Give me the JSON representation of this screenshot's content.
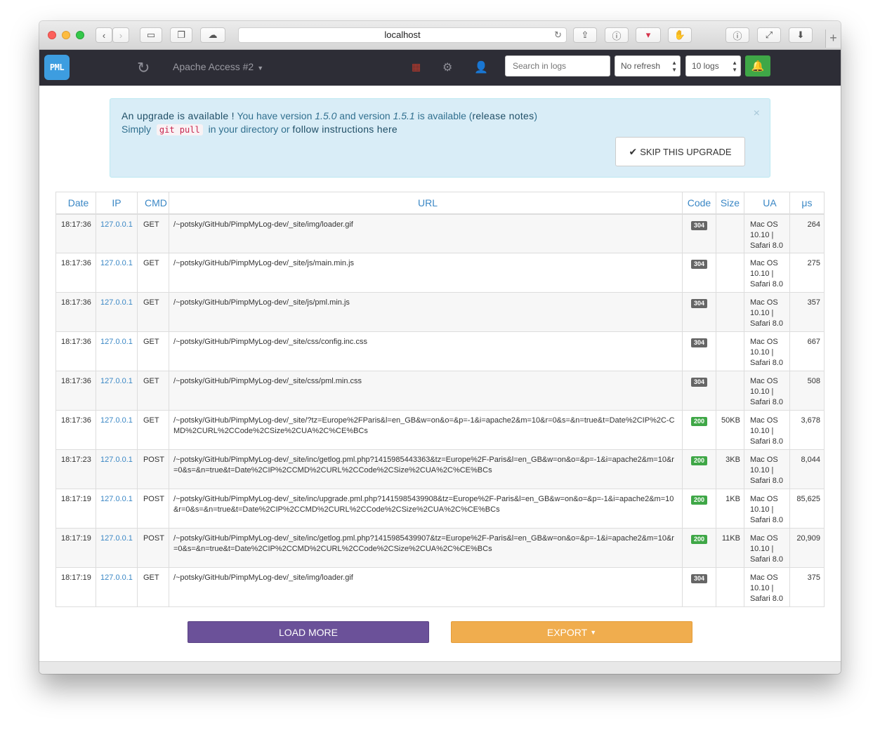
{
  "browser": {
    "url": "localhost"
  },
  "navbar": {
    "logo_text": "PML",
    "log_title": "Apache Access #2",
    "search_placeholder": "Search in logs",
    "refresh_selected": "No refresh",
    "logs_selected": "10 logs"
  },
  "alert": {
    "upgrade_available": "An upgrade is available !",
    "you_have": "You have version",
    "current_version": "1.5.0",
    "and_version": "and version",
    "new_version": "1.5.1",
    "is_available": "is available (",
    "release_notes": "release notes",
    "paren_close": ")",
    "simply": "Simply",
    "git_pull": "git pull",
    "in_dir": "in your directory or",
    "follow": "follow instructions here",
    "close": "×",
    "skip_label": "SKIP THIS UPGRADE"
  },
  "table": {
    "headers": [
      "Date",
      "IP",
      "CMD",
      "URL",
      "Code",
      "Size",
      "UA",
      "μs"
    ],
    "rows": [
      {
        "date": "18:17:36",
        "ip": "127.0.0.1",
        "cmd": "GET",
        "url": "/~potsky/GitHub/PimpMyLog-dev/_site/img/loader.gif",
        "code": "304",
        "size": "",
        "ua": "Mac OS 10.10 | Safari 8.0",
        "us": "264"
      },
      {
        "date": "18:17:36",
        "ip": "127.0.0.1",
        "cmd": "GET",
        "url": "/~potsky/GitHub/PimpMyLog-dev/_site/js/main.min.js",
        "code": "304",
        "size": "",
        "ua": "Mac OS 10.10 | Safari 8.0",
        "us": "275"
      },
      {
        "date": "18:17:36",
        "ip": "127.0.0.1",
        "cmd": "GET",
        "url": "/~potsky/GitHub/PimpMyLog-dev/_site/js/pml.min.js",
        "code": "304",
        "size": "",
        "ua": "Mac OS 10.10 | Safari 8.0",
        "us": "357"
      },
      {
        "date": "18:17:36",
        "ip": "127.0.0.1",
        "cmd": "GET",
        "url": "/~potsky/GitHub/PimpMyLog-dev/_site/css/config.inc.css",
        "code": "304",
        "size": "",
        "ua": "Mac OS 10.10 | Safari 8.0",
        "us": "667"
      },
      {
        "date": "18:17:36",
        "ip": "127.0.0.1",
        "cmd": "GET",
        "url": "/~potsky/GitHub/PimpMyLog-dev/_site/css/pml.min.css",
        "code": "304",
        "size": "",
        "ua": "Mac OS 10.10 | Safari 8.0",
        "us": "508"
      },
      {
        "date": "18:17:36",
        "ip": "127.0.0.1",
        "cmd": "GET",
        "url": "/~potsky/GitHub/PimpMyLog-dev/_site/?tz=Europe%2FParis&l=en_GB&w=on&o=&p=-1&i=apache2&m=10&r=0&s=&n=true&t=Date%2CIP%2C-CMD%2CURL%2CCode%2CSize%2CUA%2C%CE%BCs",
        "code": "200",
        "size": "50KB",
        "ua": "Mac OS 10.10 | Safari 8.0",
        "us": "3,678"
      },
      {
        "date": "18:17:23",
        "ip": "127.0.0.1",
        "cmd": "POST",
        "url": "/~potsky/GitHub/PimpMyLog-dev/_site/inc/getlog.pml.php?1415985443363&tz=Europe%2F-Paris&l=en_GB&w=on&o=&p=-1&i=apache2&m=10&r=0&s=&n=true&t=Date%2CIP%2CCMD%2CURL%2CCode%2CSize%2CUA%2C%CE%BCs",
        "code": "200",
        "size": "3KB",
        "ua": "Mac OS 10.10 | Safari 8.0",
        "us": "8,044"
      },
      {
        "date": "18:17:19",
        "ip": "127.0.0.1",
        "cmd": "POST",
        "url": "/~potsky/GitHub/PimpMyLog-dev/_site/inc/upgrade.pml.php?1415985439908&tz=Europe%2F-Paris&l=en_GB&w=on&o=&p=-1&i=apache2&m=10&r=0&s=&n=true&t=Date%2CIP%2CCMD%2CURL%2CCode%2CSize%2CUA%2C%CE%BCs",
        "code": "200",
        "size": "1KB",
        "ua": "Mac OS 10.10 | Safari 8.0",
        "us": "85,625"
      },
      {
        "date": "18:17:19",
        "ip": "127.0.0.1",
        "cmd": "POST",
        "url": "/~potsky/GitHub/PimpMyLog-dev/_site/inc/getlog.pml.php?1415985439907&tz=Europe%2F-Paris&l=en_GB&w=on&o=&p=-1&i=apache2&m=10&r=0&s=&n=true&t=Date%2CIP%2CCMD%2CURL%2CCode%2CSize%2CUA%2C%CE%BCs",
        "code": "200",
        "size": "11KB",
        "ua": "Mac OS 10.10 | Safari 8.0",
        "us": "20,909"
      },
      {
        "date": "18:17:19",
        "ip": "127.0.0.1",
        "cmd": "GET",
        "url": "/~potsky/GitHub/PimpMyLog-dev/_site/img/loader.gif",
        "code": "304",
        "size": "",
        "ua": "Mac OS 10.10 | Safari 8.0",
        "us": "375"
      }
    ]
  },
  "actions": {
    "load_more": "LOAD MORE",
    "export": "EXPORT"
  },
  "colors": {
    "navbar_bg": "#2d2d36",
    "logo_bg": "#3d9de0",
    "alert_bg": "#d9edf7",
    "status_200": "#3fa747",
    "status_304": "#666666",
    "load_more_bg": "#6b5199",
    "export_bg": "#f0ad4e",
    "link": "#3a87c5"
  }
}
